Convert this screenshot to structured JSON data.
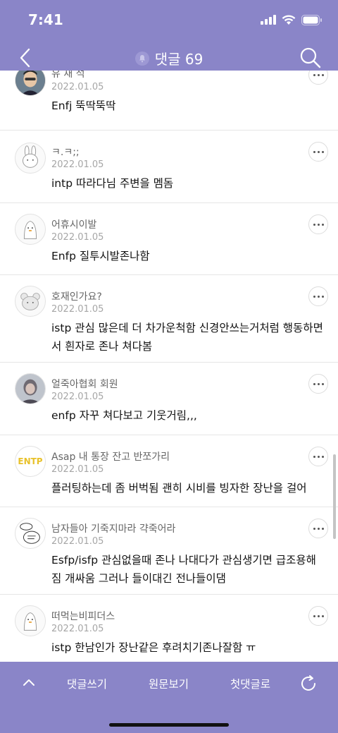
{
  "status_bar": {
    "time": "7:41"
  },
  "nav": {
    "title": "댓글 69"
  },
  "comments": [
    {
      "author": "유 재 석",
      "date": "2022.01.05",
      "text": "Enfj 뚝딱뚝딱"
    },
    {
      "author": "ㅋ.ㅋ;;",
      "date": "2022.01.05",
      "text": "intp 따라다님 주변을 멤돔"
    },
    {
      "author": "어휴시이발",
      "date": "2022.01.05",
      "text": "Enfp 질투시발존나함"
    },
    {
      "author": "호재인가요?",
      "date": "2022.01.05",
      "text": "istp 관심 많은데 더 차가운척함 신경안쓰는거처럼 행동하면서 흰자로 존나 쳐다봄"
    },
    {
      "author": "얼죽아협회 회원",
      "date": "2022.01.05",
      "text": "enfp 자꾸 쳐다보고 기웃거림,,,"
    },
    {
      "author": "Asap 내 통장 잔고 반쪼가리",
      "date": "2022.01.05",
      "text": "플러팅하는데 좀 버벅됨 괜히 시비를 빙자한 장난을 걸어",
      "avatar_text": "ENTP"
    },
    {
      "author": "남자들아 기죽지마라 갹죽어라",
      "date": "2022.01.05",
      "text": "Esfp/isfp 관심없을때 존나 나대다가 관심생기면 급조용해짐 개싸움 그러나 들이대긴 전나들이댐"
    },
    {
      "author": "떠먹는비피더스",
      "date": "2022.01.05",
      "text": "istp 한남인가 장난같은 후려치기존나잘함 ㅠ"
    }
  ],
  "bottom_bar": {
    "write": "댓글쓰기",
    "original": "원문보기",
    "first": "첫댓글로"
  },
  "colors": {
    "brand": "#8a85c8",
    "avatar_text_color": "#e8c12a"
  },
  "icons": [
    "back-arrow-icon",
    "bell-icon",
    "search-icon",
    "more-icon",
    "chevron-up-icon",
    "refresh-icon",
    "signal-icon",
    "wifi-icon",
    "battery-icon"
  ]
}
